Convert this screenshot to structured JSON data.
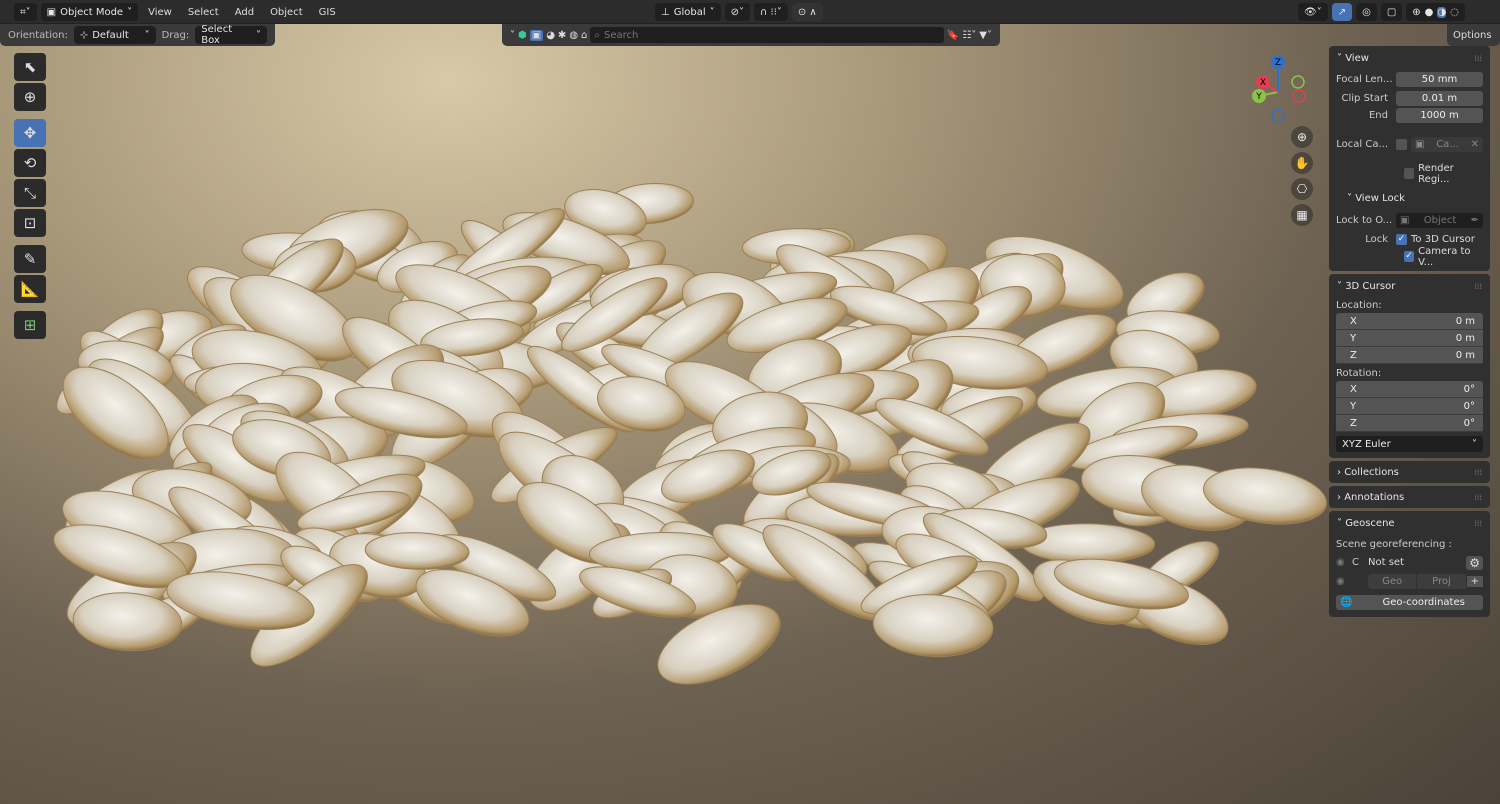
{
  "header": {
    "editor_icon": "editor-type-icon",
    "mode": "Object Mode",
    "menus": [
      "View",
      "Select",
      "Add",
      "Object",
      "GIS"
    ],
    "orientation_global": "Global"
  },
  "tool_settings": {
    "orientation_label": "Orientation:",
    "orientation_value": "Default",
    "drag_label": "Drag:",
    "drag_value": "Select Box",
    "options": "Options"
  },
  "search": {
    "placeholder": "Search"
  },
  "gizmo": {
    "x": "X",
    "y": "Y",
    "z": "Z"
  },
  "sidebar": {
    "view": {
      "title": "View",
      "focal_label": "Focal Len...",
      "focal": "50 mm",
      "clip_start_label": "Clip Start",
      "clip_start": "0.01 m",
      "end_label": "End",
      "end": "1000 m",
      "local_cam_label": "Local Ca...",
      "local_cam_value": "Ca...",
      "render_region": "Render Regi...",
      "view_lock": "View Lock",
      "lock_to_label": "Lock to O...",
      "lock_to_placeholder": "Object",
      "lock_label": "Lock",
      "to_3d_cursor": "To 3D Cursor",
      "camera_to_view": "Camera to V..."
    },
    "cursor": {
      "title": "3D Cursor",
      "location_label": "Location:",
      "loc": [
        {
          "a": "X",
          "v": "0 m"
        },
        {
          "a": "Y",
          "v": "0 m"
        },
        {
          "a": "Z",
          "v": "0 m"
        }
      ],
      "rotation_label": "Rotation:",
      "rot": [
        {
          "a": "X",
          "v": "0°"
        },
        {
          "a": "Y",
          "v": "0°"
        },
        {
          "a": "Z",
          "v": "0°"
        }
      ],
      "rotation_mode": "XYZ Euler"
    },
    "collections": "Collections",
    "annotations": "Annotations",
    "geoscene": {
      "title": "Geoscene",
      "label": "Scene georeferencing :",
      "c": "C",
      "status": "Not set",
      "geo": "Geo",
      "proj": "Proj",
      "geo_coords": "Geo-coordinates"
    }
  },
  "colors": {
    "accent": "#4772b3",
    "panel": "#303030"
  }
}
